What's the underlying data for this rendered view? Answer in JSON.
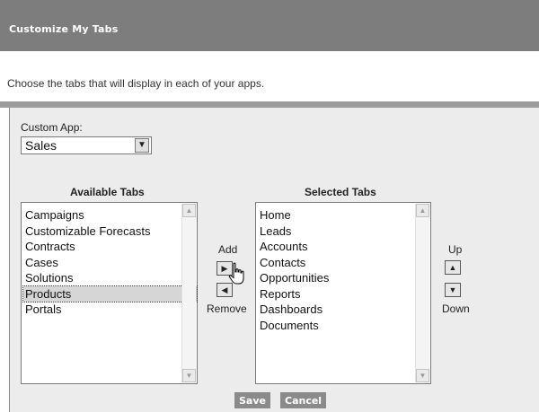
{
  "header": {
    "title": "Customize My Tabs"
  },
  "intro": {
    "text": "Choose the tabs that will display in each of your apps."
  },
  "custom_app": {
    "label": "Custom App:",
    "value": "Sales"
  },
  "available": {
    "title": "Available Tabs",
    "items": [
      "Campaigns",
      "Customizable Forecasts",
      "Contracts",
      "Cases",
      "Solutions",
      "Products",
      "Portals"
    ],
    "selected_index": 5
  },
  "selected": {
    "title": "Selected Tabs",
    "items": [
      "Home",
      "Leads",
      "Accounts",
      "Contacts",
      "Opportunities",
      "Reports",
      "Dashboards",
      "Documents"
    ]
  },
  "move": {
    "add_label": "Add",
    "remove_label": "Remove"
  },
  "order": {
    "up_label": "Up",
    "down_label": "Down"
  },
  "buttons": {
    "save": "Save",
    "cancel": "Cancel"
  },
  "icons": {
    "dropdown": "chevron-down-icon",
    "add": "arrow-right-icon",
    "remove": "arrow-left-icon",
    "up": "arrow-up-icon",
    "down": "arrow-down-icon",
    "cursor": "hand-pointer-icon"
  }
}
